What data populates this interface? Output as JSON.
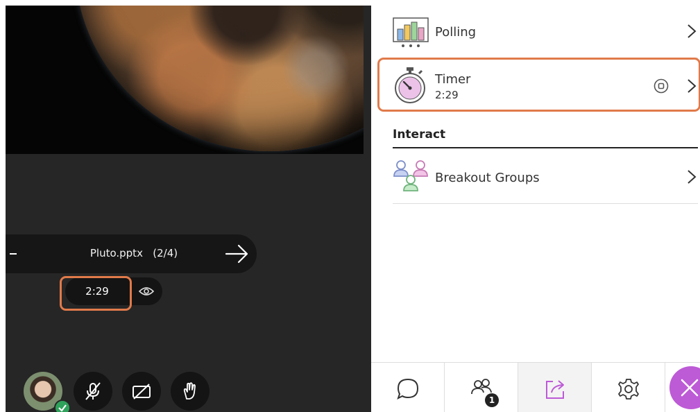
{
  "stage": {
    "file_name": "Pluto.pptx",
    "file_page": "(2/4)",
    "timer": "2:29"
  },
  "panel": {
    "polling_label": "Polling",
    "timer_label": "Timer",
    "timer_value": "2:29",
    "interact_heading": "Interact",
    "breakout_label": "Breakout Groups"
  },
  "bottom_bar": {
    "attendees_badge": "1"
  },
  "colors": {
    "highlight": "#e17a4a",
    "accent": "#bd5ad6",
    "stage_bg": "#262626"
  }
}
